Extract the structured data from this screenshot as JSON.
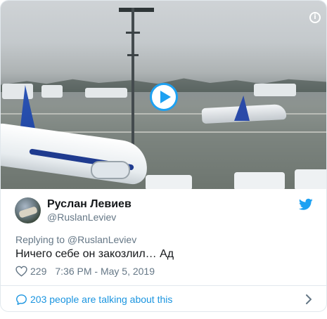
{
  "tweet": {
    "display_name": "Руслан Левиев",
    "handle": "@RuslanLeviev",
    "reply_to": "Replying to @RuslanLeviev",
    "text": "Ничего себе он закозлил… Ад",
    "like_count": "229",
    "timestamp": "7:36 PM - May 5, 2019"
  },
  "footer": {
    "talking_label": "203 people are talking about this"
  },
  "media": {
    "info_icon_glyph": "i",
    "play_icon": "play-icon"
  },
  "icons": {
    "brand": "twitter-bird-icon",
    "like": "heart-icon",
    "comment": "comment-icon",
    "more": "chevron-right-icon",
    "info": "info-icon"
  },
  "colors": {
    "brand_blue": "#1da1f2",
    "link_blue": "#1b95e0",
    "secondary_text": "#657786",
    "primary_text": "#14171a",
    "border": "#e1e8ed"
  }
}
